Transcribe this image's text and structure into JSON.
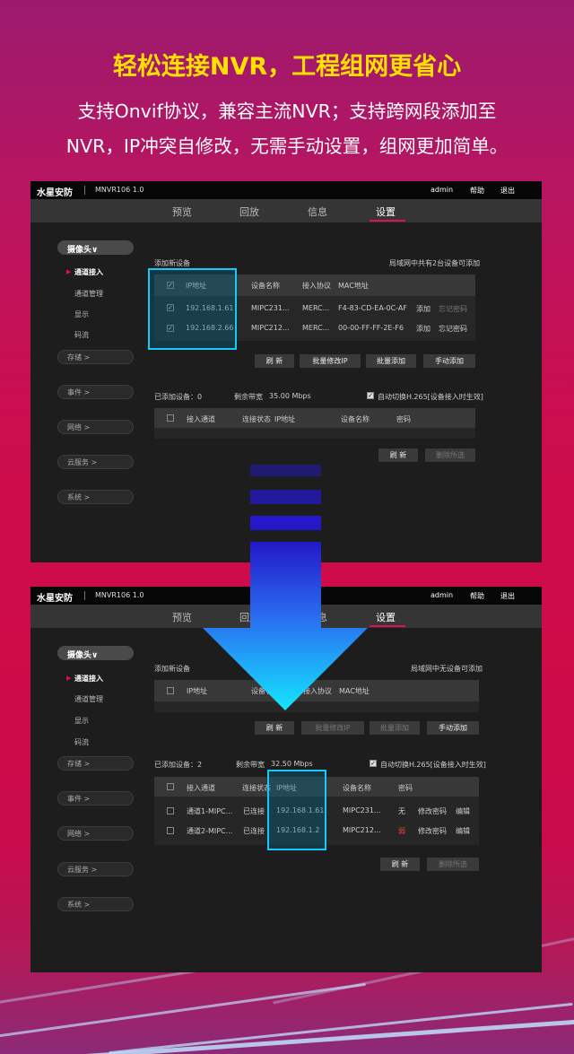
{
  "hero": {
    "title": "轻松连接NVR，工程组网更省心",
    "line1": "支持Onvif协议，兼容主流NVR；支持跨网段添加至",
    "line2": "NVR，IP冲突自修改，无需手动设置，组网更加简单。"
  },
  "app": {
    "brand": "水星安防",
    "model": "MNVR106 1.0",
    "user": "admin",
    "help": "帮助",
    "logout": "退出",
    "tabs": [
      "预览",
      "回放",
      "信息",
      "设置"
    ],
    "sidebar": {
      "camera": "摄像头∨",
      "items": [
        "通道接入",
        "通道管理",
        "显示",
        "码流"
      ],
      "groups": [
        "存储 >",
        "事件 >",
        "网络 >",
        "云服务 >",
        "系统 >"
      ]
    }
  },
  "before": {
    "add_title": "添加新设备",
    "lan_info": "局域网中共有2台设备可添加",
    "cols": [
      "IP地址",
      "设备名称",
      "接入协议",
      "MAC地址"
    ],
    "rows": [
      {
        "ip": "192.168.1.61",
        "name": "MIPC231...",
        "proto": "MERC...",
        "mac": "F4-83-CD-EA-0C-AF",
        "add": "添加",
        "pwd": "忘记密码"
      },
      {
        "ip": "192.168.2.66",
        "name": "MIPC212...",
        "proto": "MERC...",
        "mac": "00-00-FF-FF-2E-F6",
        "add": "添加",
        "pwd": "忘记密码"
      }
    ],
    "buttons": [
      "刷 新",
      "批量修改IP",
      "批量添加",
      "手动添加"
    ],
    "added": "已添加设备：0",
    "bw_label": "剩余带宽",
    "bw": "35.00 Mbps",
    "auto": "自动切换H.265[设备接入时生效]",
    "cols2": [
      "接入通道",
      "连接状态",
      "IP地址",
      "设备名称",
      "密码"
    ],
    "buttons2": [
      "刷 新",
      "删除所选"
    ]
  },
  "after": {
    "add_title": "添加新设备",
    "lan_info": "局域网中无设备可添加",
    "cols": [
      "IP地址",
      "设备名称",
      "接入协议",
      "MAC地址"
    ],
    "buttons": [
      "刷 新",
      "批量修改IP",
      "批量添加",
      "手动添加"
    ],
    "added": "已添加设备：2",
    "bw_label": "剩余带宽",
    "bw": "32.50 Mbps",
    "auto": "自动切换H.265[设备接入时生效]",
    "cols2": [
      "接入通道",
      "连接状态",
      "IP地址",
      "设备名称",
      "密码"
    ],
    "rows": [
      {
        "ch": "通道1-MIPC...",
        "status": "已连接",
        "ip": "192.168.1.61",
        "name": "MIPC231...",
        "pwd_level": "无",
        "edit_pwd": "修改密码",
        "edit": "编辑"
      },
      {
        "ch": "通道2-MIPC...",
        "status": "已连接",
        "ip": "192.168.1.2",
        "name": "MIPC212...",
        "pwd_level": "弱",
        "edit_pwd": "修改密码",
        "edit": "编辑"
      }
    ],
    "buttons2": [
      "刷 新",
      "删除所选"
    ]
  },
  "colors": {
    "accent": "#e01050",
    "highlight": "#18c8f8",
    "headline": "#ffe000",
    "weak": "#ff3b3b"
  }
}
